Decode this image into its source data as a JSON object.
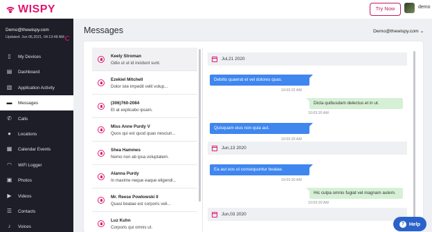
{
  "brand": {
    "name": "WISPY",
    "color": "#e0166f"
  },
  "topbar": {
    "try_label": "Try Now",
    "user": "demo"
  },
  "sidebar": {
    "email": "Demo@thewispy.com",
    "updated": "Updated: Jun 06,2021, 04:13:48 AM",
    "items": [
      {
        "label": "My Devices",
        "icon": "phone-icon"
      },
      {
        "label": "Dashboard",
        "icon": "dashboard-icon"
      },
      {
        "label": "Application Activity",
        "icon": "chart-icon"
      },
      {
        "label": "Messages",
        "icon": "chat-icon"
      },
      {
        "label": "Calls",
        "icon": "call-icon"
      },
      {
        "label": "Locations",
        "icon": "location-icon"
      },
      {
        "label": "Calendar Events",
        "icon": "calendar-icon"
      },
      {
        "label": "WiFi Logger",
        "icon": "wifi-icon"
      },
      {
        "label": "Photos",
        "icon": "photo-icon"
      },
      {
        "label": "Videos",
        "icon": "video-icon"
      },
      {
        "label": "Contacts",
        "icon": "contacts-icon"
      },
      {
        "label": "Voices",
        "icon": "mic-icon"
      }
    ]
  },
  "main": {
    "title": "Messages",
    "account": "Demo@thewispy.com"
  },
  "contacts": [
    {
      "name": "Keely Stroman",
      "preview": "Odio ut ut id incidunt sunt."
    },
    {
      "name": "Ezekiel Mitchell",
      "preview": "Dolor iste impedit velit volup..."
    },
    {
      "name": "(306)760-2084",
      "preview": "Et at explicabo ipsam."
    },
    {
      "name": "Miss Anne Purdy V",
      "preview": "Quos qui est quod quas nesciun..."
    },
    {
      "name": "Shea Hammes",
      "preview": "Nemo non ab ipsa voluptatem."
    },
    {
      "name": "Alanna Purdy",
      "preview": "In maxime neque eaque eligendi..."
    },
    {
      "name": "Mr. Reese Powlowski II",
      "preview": "Quasi beatae est corporis veli..."
    },
    {
      "name": "Luz Kuhn",
      "preview": "Corporis qui omnis ut."
    }
  ],
  "conversation": {
    "dates": [
      "Jul,21 2020",
      "Jun,13 2020",
      "Jun,03 2020"
    ],
    "messages": [
      {
        "text": "Debitis quaerat et vel dolores quas.",
        "time": "10:03:22 AM"
      },
      {
        "text": "Dicta quibusdam delectus et in ut.",
        "time": "10:03:20 AM"
      },
      {
        "text": "Quisquam eius non quia aut.",
        "time": "10:03:20 AM"
      },
      {
        "text": "Ea aut eos ut consequuntur beatae.",
        "time": "10:03:20 AM"
      },
      {
        "text": "Hic culpa omnis fugiat vel magnam autem.",
        "time": "10:03:20 AM"
      }
    ]
  },
  "help": {
    "label": "Help"
  }
}
